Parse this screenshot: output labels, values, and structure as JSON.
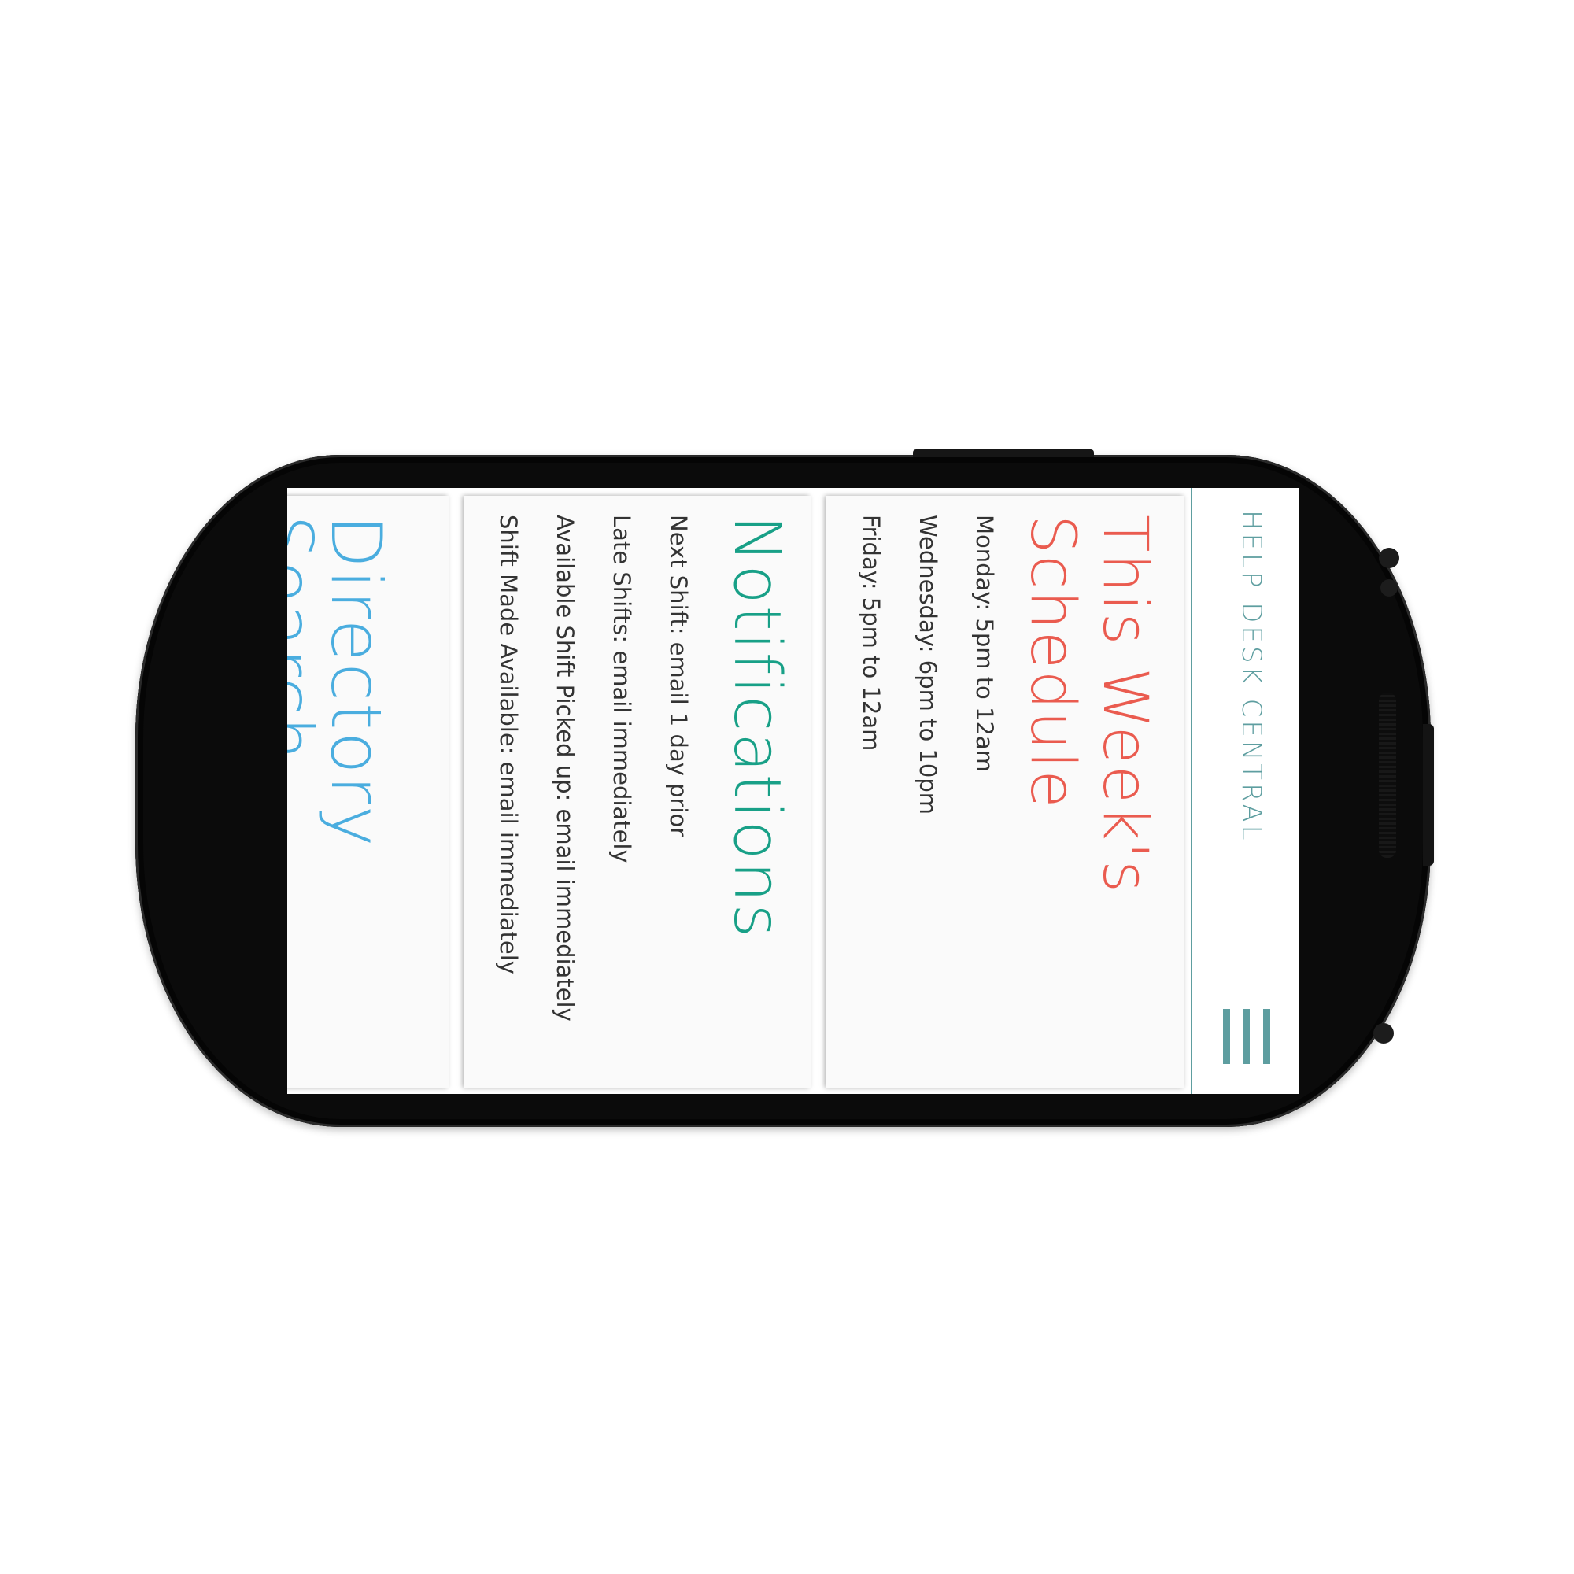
{
  "app": {
    "title": "HELP DESK CENTRAL",
    "accent_color": "#5e9ea0",
    "menu_icon": "hamburger-menu-icon"
  },
  "schedule": {
    "title_line1": "This Week's",
    "title_line2": "Schedule",
    "title_color": "#ea5b4f",
    "items": [
      "Monday: 5pm to 12am",
      "Wednesday: 6pm to 10pm",
      "Friday: 5pm to 12am"
    ]
  },
  "notifications": {
    "title": "Notifications",
    "title_color": "#18a087",
    "items": [
      "Next Shift: email 1 day prior",
      "Late Shifts: email immediately",
      "Available Shift Picked up: email immediately",
      "Shift Made Available: email immediately"
    ]
  },
  "directory": {
    "title": "Directory Search",
    "title_color": "#4aaddf"
  }
}
